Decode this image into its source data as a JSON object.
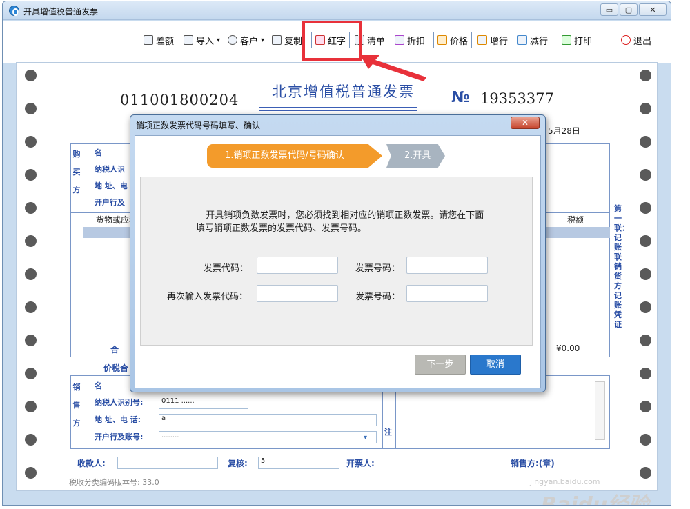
{
  "window": {
    "title": "开具增值税普通发票",
    "minimize": "▭",
    "maximize": "▢",
    "close": "✕"
  },
  "toolbar": {
    "items": [
      {
        "label": "差额",
        "icon": "list-icon"
      },
      {
        "label": "导入",
        "icon": "import-icon",
        "dropdown": true
      },
      {
        "label": "客户",
        "icon": "customer-icon",
        "dropdown": true
      },
      {
        "label": "复制",
        "icon": "copy-icon"
      },
      {
        "label": "红字",
        "icon": "red-invoice-icon",
        "highlighted": true
      },
      {
        "label": "清单",
        "icon": "detail-list-icon"
      },
      {
        "label": "折扣",
        "icon": "discount-icon"
      },
      {
        "label": "价格",
        "icon": "price-icon"
      },
      {
        "label": "增行",
        "icon": "add-row-icon"
      },
      {
        "label": "减行",
        "icon": "remove-row-icon"
      },
      {
        "label": "打印",
        "icon": "printer-icon"
      },
      {
        "label": "退出",
        "icon": "power-icon"
      }
    ],
    "dropdown_glyph": "▾",
    "highlight_color": "#e8313a"
  },
  "invoice": {
    "code": "011001800204",
    "title": "北京增值税普通发票",
    "number_symbol": "№",
    "number": "19353377",
    "date_partial": "5月28日",
    "buyer_heading": "购买方",
    "buyer_fields": [
      "名",
      "纳税人识",
      "地 址、电",
      "开户行及"
    ],
    "goods_header_name": "货物或应税",
    "goods_header_tax": "税额",
    "sum_label": "合",
    "sum_value": "¥0.00",
    "total_label": "价税合",
    "seller_heading": "销售方",
    "seller_fields": [
      "名",
      "纳税人识别号:",
      "地 址、电 话:",
      "开户行及账号:"
    ],
    "seller_values": [
      "0111      ......",
      "a",
      "........"
    ],
    "remark_label": "注",
    "side_text": "第一联：记账联 销货方记账凭证",
    "payee_label": "收款人:",
    "reviewer_label": "复核:",
    "reviewer_value": "5",
    "issuer_label": "开票人:",
    "seller_stamp_label": "销售方:(章)",
    "version": "税收分类编码版本号: 33.0",
    "accent_color": "#2b4fa5"
  },
  "dialog": {
    "title": "销项正数发票代码号码填写、确认",
    "close": "✕",
    "step1": "1.销项正数发票代码/号码确认",
    "step2": "2.开具",
    "message": "开具销项负数发票时，您必须找到相对应的销项正数发票。请您在下面填写销项正数发票的发票代码、发票号码。",
    "label_code": "发票代码：",
    "label_number": "发票号码：",
    "label_code_again": "再次输入发票代码：",
    "label_number_again": "发票号码：",
    "next_button": "下一步",
    "cancel_button": "取消",
    "step_active_color": "#f39b2b",
    "cancel_color": "#2a78cc"
  },
  "watermark": {
    "text": "Baidu经验",
    "url_text": "jingyan.baidu.com"
  }
}
